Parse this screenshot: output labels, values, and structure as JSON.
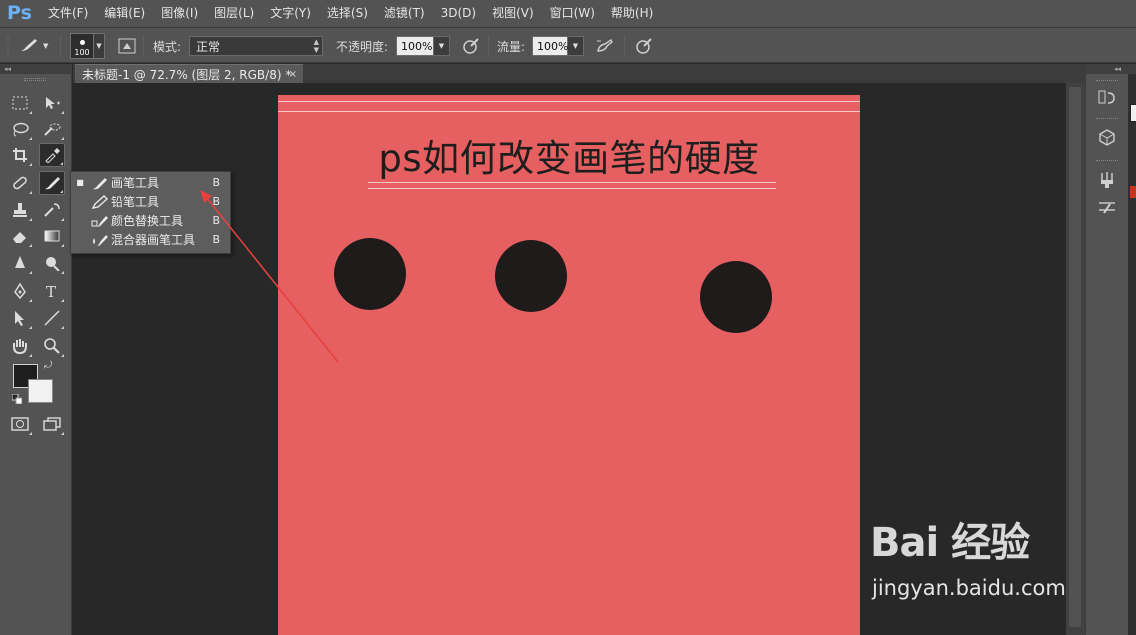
{
  "app": {
    "logo": "Ps"
  },
  "menu": [
    "文件(F)",
    "编辑(E)",
    "图像(I)",
    "图层(L)",
    "文字(Y)",
    "选择(S)",
    "滤镜(T)",
    "3D(D)",
    "视图(V)",
    "窗口(W)",
    "帮助(H)"
  ],
  "options": {
    "brush_size": "100",
    "mode_label": "模式:",
    "mode_value": "正常",
    "opacity_label": "不透明度:",
    "opacity_value": "100%",
    "flow_label": "流量:",
    "flow_value": "100%"
  },
  "document_tab": {
    "title": "未标题-1 @ 72.7% (图层 2, RGB/8) *",
    "close": "×"
  },
  "flyout": [
    {
      "label": "画笔工具",
      "shortcut": "B",
      "selected": true,
      "icon": "brush-icon"
    },
    {
      "label": "铅笔工具",
      "shortcut": "B",
      "selected": false,
      "icon": "pencil-icon"
    },
    {
      "label": "颜色替换工具",
      "shortcut": "B",
      "selected": false,
      "icon": "color-replace-icon"
    },
    {
      "label": "混合器画笔工具",
      "shortcut": "B",
      "selected": false,
      "icon": "mixer-brush-icon"
    }
  ],
  "canvas": {
    "title": "ps如何改变画笔的硬度",
    "background_color": "#e76061",
    "dot_color": "#1f1b1b",
    "dot_count": 3
  },
  "annotation": {
    "arrow_color": "#e8403f"
  },
  "colors": {
    "foreground": "#1e1e1e",
    "background": "#f2f2f2"
  },
  "watermark": {
    "logo": "Bai 经验",
    "url": "jingyan.baidu.com"
  }
}
